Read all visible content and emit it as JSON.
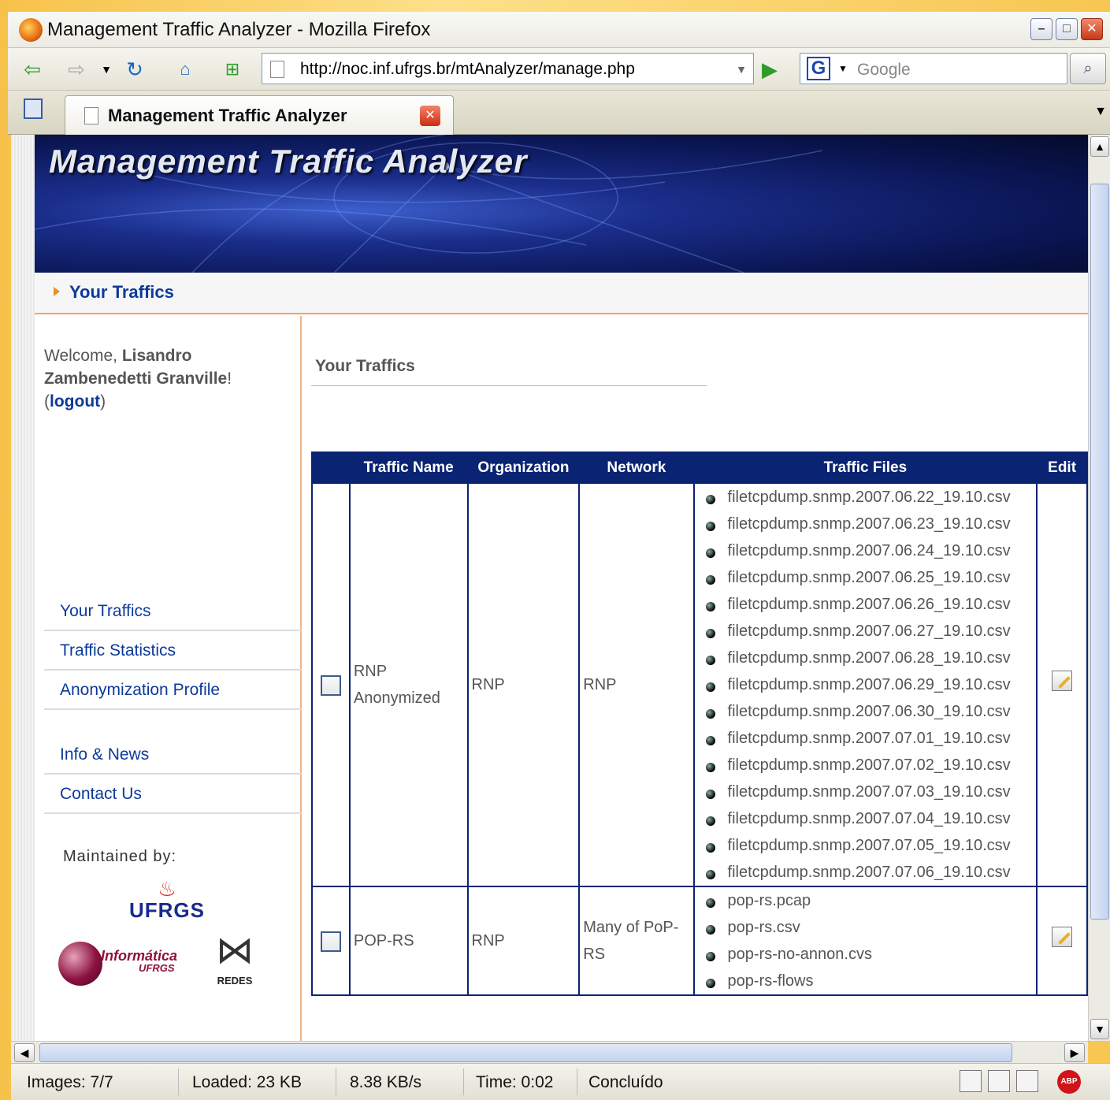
{
  "window": {
    "title": "Management Traffic Analyzer - Mozilla Firefox"
  },
  "toolbar": {
    "url": "http://noc.inf.ufrgs.br/mtAnalyzer/manage.php",
    "search_placeholder": "Google"
  },
  "tabs": [
    {
      "label": "Management Traffic Analyzer"
    }
  ],
  "page": {
    "banner_title": "Management Traffic Analyzer",
    "breadcrumb": "Your Traffics",
    "welcome_prefix": "Welcome, ",
    "user_name": "Lisandro Zambenedetti Granville",
    "welcome_suffix": "!",
    "logout_label": "logout",
    "nav": [
      {
        "label": "Your Traffics"
      },
      {
        "label": "Traffic Statistics"
      },
      {
        "label": "Anonymization Profile"
      },
      {
        "label": "Info & News"
      },
      {
        "label": "Contact Us"
      }
    ],
    "maintained_by": "Maintained by:",
    "logos": {
      "ufrgs": "UFRGS",
      "informatica": "Informática",
      "informatica_sub": "UFRGS",
      "redes": "REDES"
    },
    "main_title": "Your Traffics"
  },
  "table": {
    "headers": [
      "",
      "Traffic Name",
      "Organization",
      "Network",
      "Traffic Files",
      "Edit"
    ],
    "rows": [
      {
        "name": "RNP Anonymized",
        "organization": "RNP",
        "network": "RNP",
        "files": [
          "filetcpdump.snmp.2007.06.22_19.10.csv",
          "filetcpdump.snmp.2007.06.23_19.10.csv",
          "filetcpdump.snmp.2007.06.24_19.10.csv",
          "filetcpdump.snmp.2007.06.25_19.10.csv",
          "filetcpdump.snmp.2007.06.26_19.10.csv",
          "filetcpdump.snmp.2007.06.27_19.10.csv",
          "filetcpdump.snmp.2007.06.28_19.10.csv",
          "filetcpdump.snmp.2007.06.29_19.10.csv",
          "filetcpdump.snmp.2007.06.30_19.10.csv",
          "filetcpdump.snmp.2007.07.01_19.10.csv",
          "filetcpdump.snmp.2007.07.02_19.10.csv",
          "filetcpdump.snmp.2007.07.03_19.10.csv",
          "filetcpdump.snmp.2007.07.04_19.10.csv",
          "filetcpdump.snmp.2007.07.05_19.10.csv",
          "filetcpdump.snmp.2007.07.06_19.10.csv"
        ]
      },
      {
        "name": "POP-RS",
        "organization": "RNP",
        "network": "Many of PoP-RS",
        "files": [
          "pop-rs.pcap",
          "pop-rs.csv",
          "pop-rs-no-annon.cvs",
          "pop-rs-flows"
        ]
      }
    ]
  },
  "status": {
    "images": "Images: 7/7",
    "loaded": "Loaded: 23 KB",
    "speed": "8.38 KB/s",
    "time": "Time: 0:02",
    "state": "Concluído"
  },
  "icons": {
    "abp": "ABP"
  }
}
